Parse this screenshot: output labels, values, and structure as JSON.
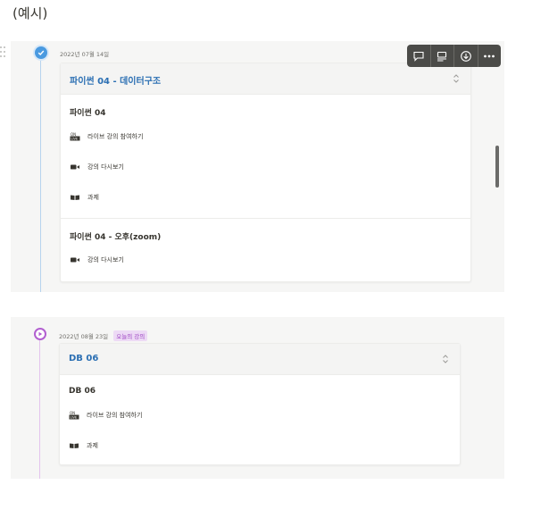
{
  "page": {
    "heading": "(예시)"
  },
  "toolbar": {
    "buttons": [
      "comment-icon",
      "caption-icon",
      "download-icon",
      "more-icon"
    ]
  },
  "lessons": [
    {
      "date": "2022년 07월 14일",
      "status": "completed",
      "title": "파이썬 04 - 데이터구조",
      "sections": [
        {
          "title": "파이썬 04",
          "items": [
            {
              "icon": "live-icon",
              "label": "라이브 강의 참여하기"
            },
            {
              "icon": "video-icon",
              "label": "강의 다시보기"
            },
            {
              "icon": "book-icon",
              "label": "과제"
            }
          ]
        },
        {
          "title": "파이썬 04 - 오후(zoom)",
          "items": [
            {
              "icon": "video-icon",
              "label": "강의 다시보기"
            }
          ]
        }
      ]
    },
    {
      "date": "2022년 08월 23일",
      "badge": "오늘의 강의",
      "status": "current",
      "title": "DB 06",
      "sections": [
        {
          "title": "DB 06",
          "items": [
            {
              "icon": "live-icon",
              "label": "라이브 강의 참여하기"
            },
            {
              "icon": "book-icon",
              "label": "과제"
            }
          ]
        }
      ]
    }
  ],
  "colors": {
    "accent_blue": "#4a9ae0",
    "accent_purple": "#b25fd0",
    "title_blue": "#2b6fb3"
  }
}
